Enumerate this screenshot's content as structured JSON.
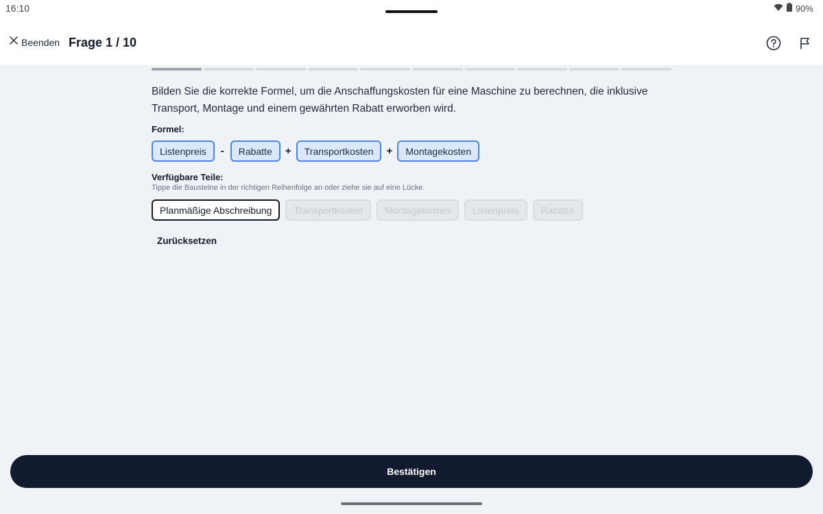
{
  "status_bar": {
    "time": "16:10",
    "battery": "90%",
    "icons": [
      "wifi-icon",
      "battery-icon"
    ]
  },
  "header": {
    "quit_label": "Beenden",
    "title": "Frage 1 / 10",
    "icons": [
      "close-icon",
      "help-icon",
      "flag-icon"
    ]
  },
  "progress": {
    "current": 1,
    "total": 10
  },
  "question": "Bilden Sie die korrekte Formel, um die Anschaffungskosten für eine Maschine zu berechnen, die inklusive Transport, Montage und einem gewährten Rabatt erworben wird.",
  "formula": {
    "label": "Formel:",
    "terms": [
      "Listenpreis",
      "Rabatte",
      "Transportkosten",
      "Montagekosten"
    ],
    "operators": [
      "-",
      "+",
      "+"
    ]
  },
  "parts": {
    "label": "Verfügbare Teile:",
    "hint": "Tippe die Bausteine in der richtigen Reihenfolge an oder ziehe sie auf eine Lücke.",
    "items": [
      {
        "label": "Planmäßige Abschreibung",
        "used": false
      },
      {
        "label": "Transportkosten",
        "used": true
      },
      {
        "label": "Montagekosten",
        "used": true
      },
      {
        "label": "Listenpreis",
        "used": true
      },
      {
        "label": "Rabatte",
        "used": true
      }
    ]
  },
  "reset_label": "Zurücksetzen",
  "confirm_label": "Bestätigen",
  "colors": {
    "accent": "#4a86e0",
    "chip_fill": "#dbe8fb",
    "primary_button": "#111a2e",
    "background": "#eff2f7"
  }
}
